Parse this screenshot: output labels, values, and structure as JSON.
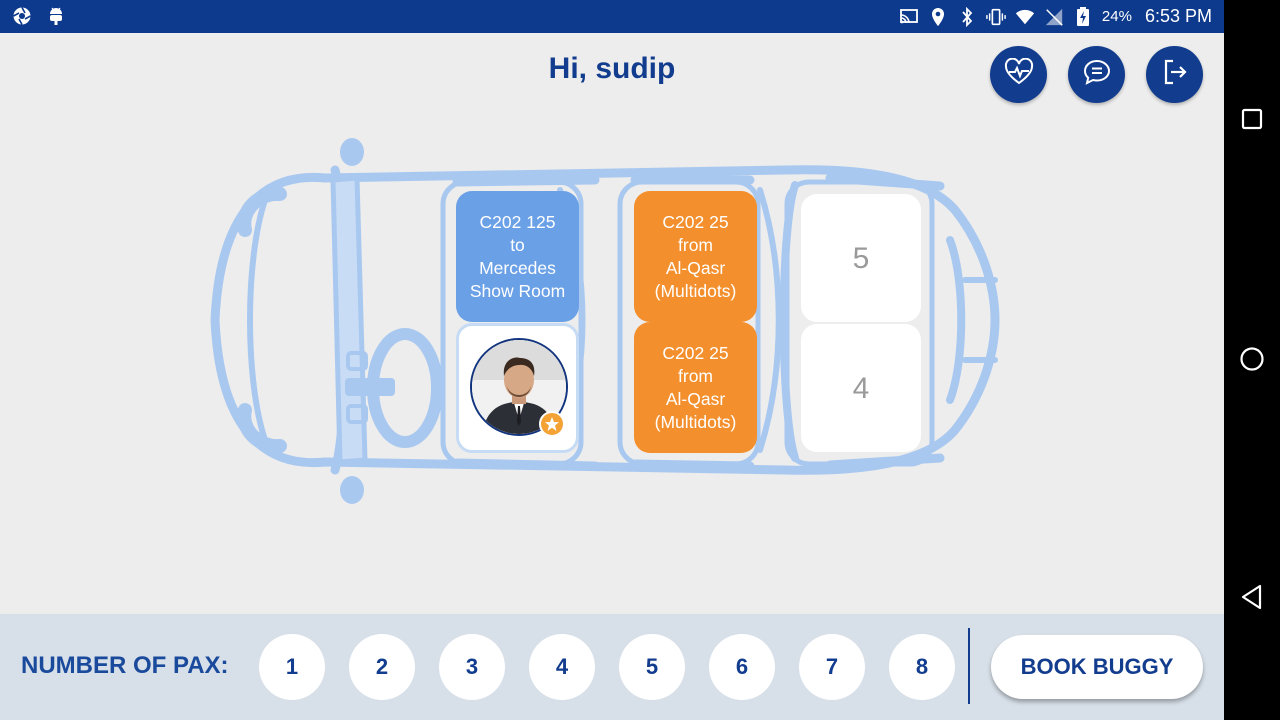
{
  "status_bar": {
    "battery": "24%",
    "time": "6:53 PM",
    "icons": [
      "shutter-icon",
      "android-icon",
      "cast-icon",
      "location-icon",
      "bluetooth-icon",
      "vibrate-icon",
      "wifi-icon",
      "no-signal-icon",
      "battery-charging-icon"
    ]
  },
  "header": {
    "greeting": "Hi, sudip",
    "actions": [
      "health-icon",
      "chat-icon",
      "logout-icon"
    ]
  },
  "seats": {
    "front_top": {
      "lines": [
        "C202 125",
        "to",
        "Mercedes",
        "Show Room"
      ]
    },
    "front_bottom": {
      "occupant": "avatar",
      "badge": "medal-icon"
    },
    "mid_top": {
      "lines": [
        "C202 25",
        "from",
        "Al-Qasr",
        "(Multidots)"
      ]
    },
    "mid_bottom": {
      "lines": [
        "C202 25",
        "from",
        "Al-Qasr",
        "(Multidots)"
      ]
    },
    "rear_top": {
      "label": "5"
    },
    "rear_bottom": {
      "label": "4"
    }
  },
  "pax": {
    "label": "NUMBER OF PAX:",
    "options": [
      "1",
      "2",
      "3",
      "4",
      "5",
      "6",
      "7",
      "8"
    ]
  },
  "book_button": "BOOK BUGGY",
  "colors": {
    "primary": "#123c8e",
    "status_bar": "#0d3a8c",
    "seat_blue": "#6aa0e6",
    "seat_orange": "#f38f2c",
    "vehicle_outline": "#a9c8f0",
    "bottom_bar": "#d7dfe8"
  }
}
